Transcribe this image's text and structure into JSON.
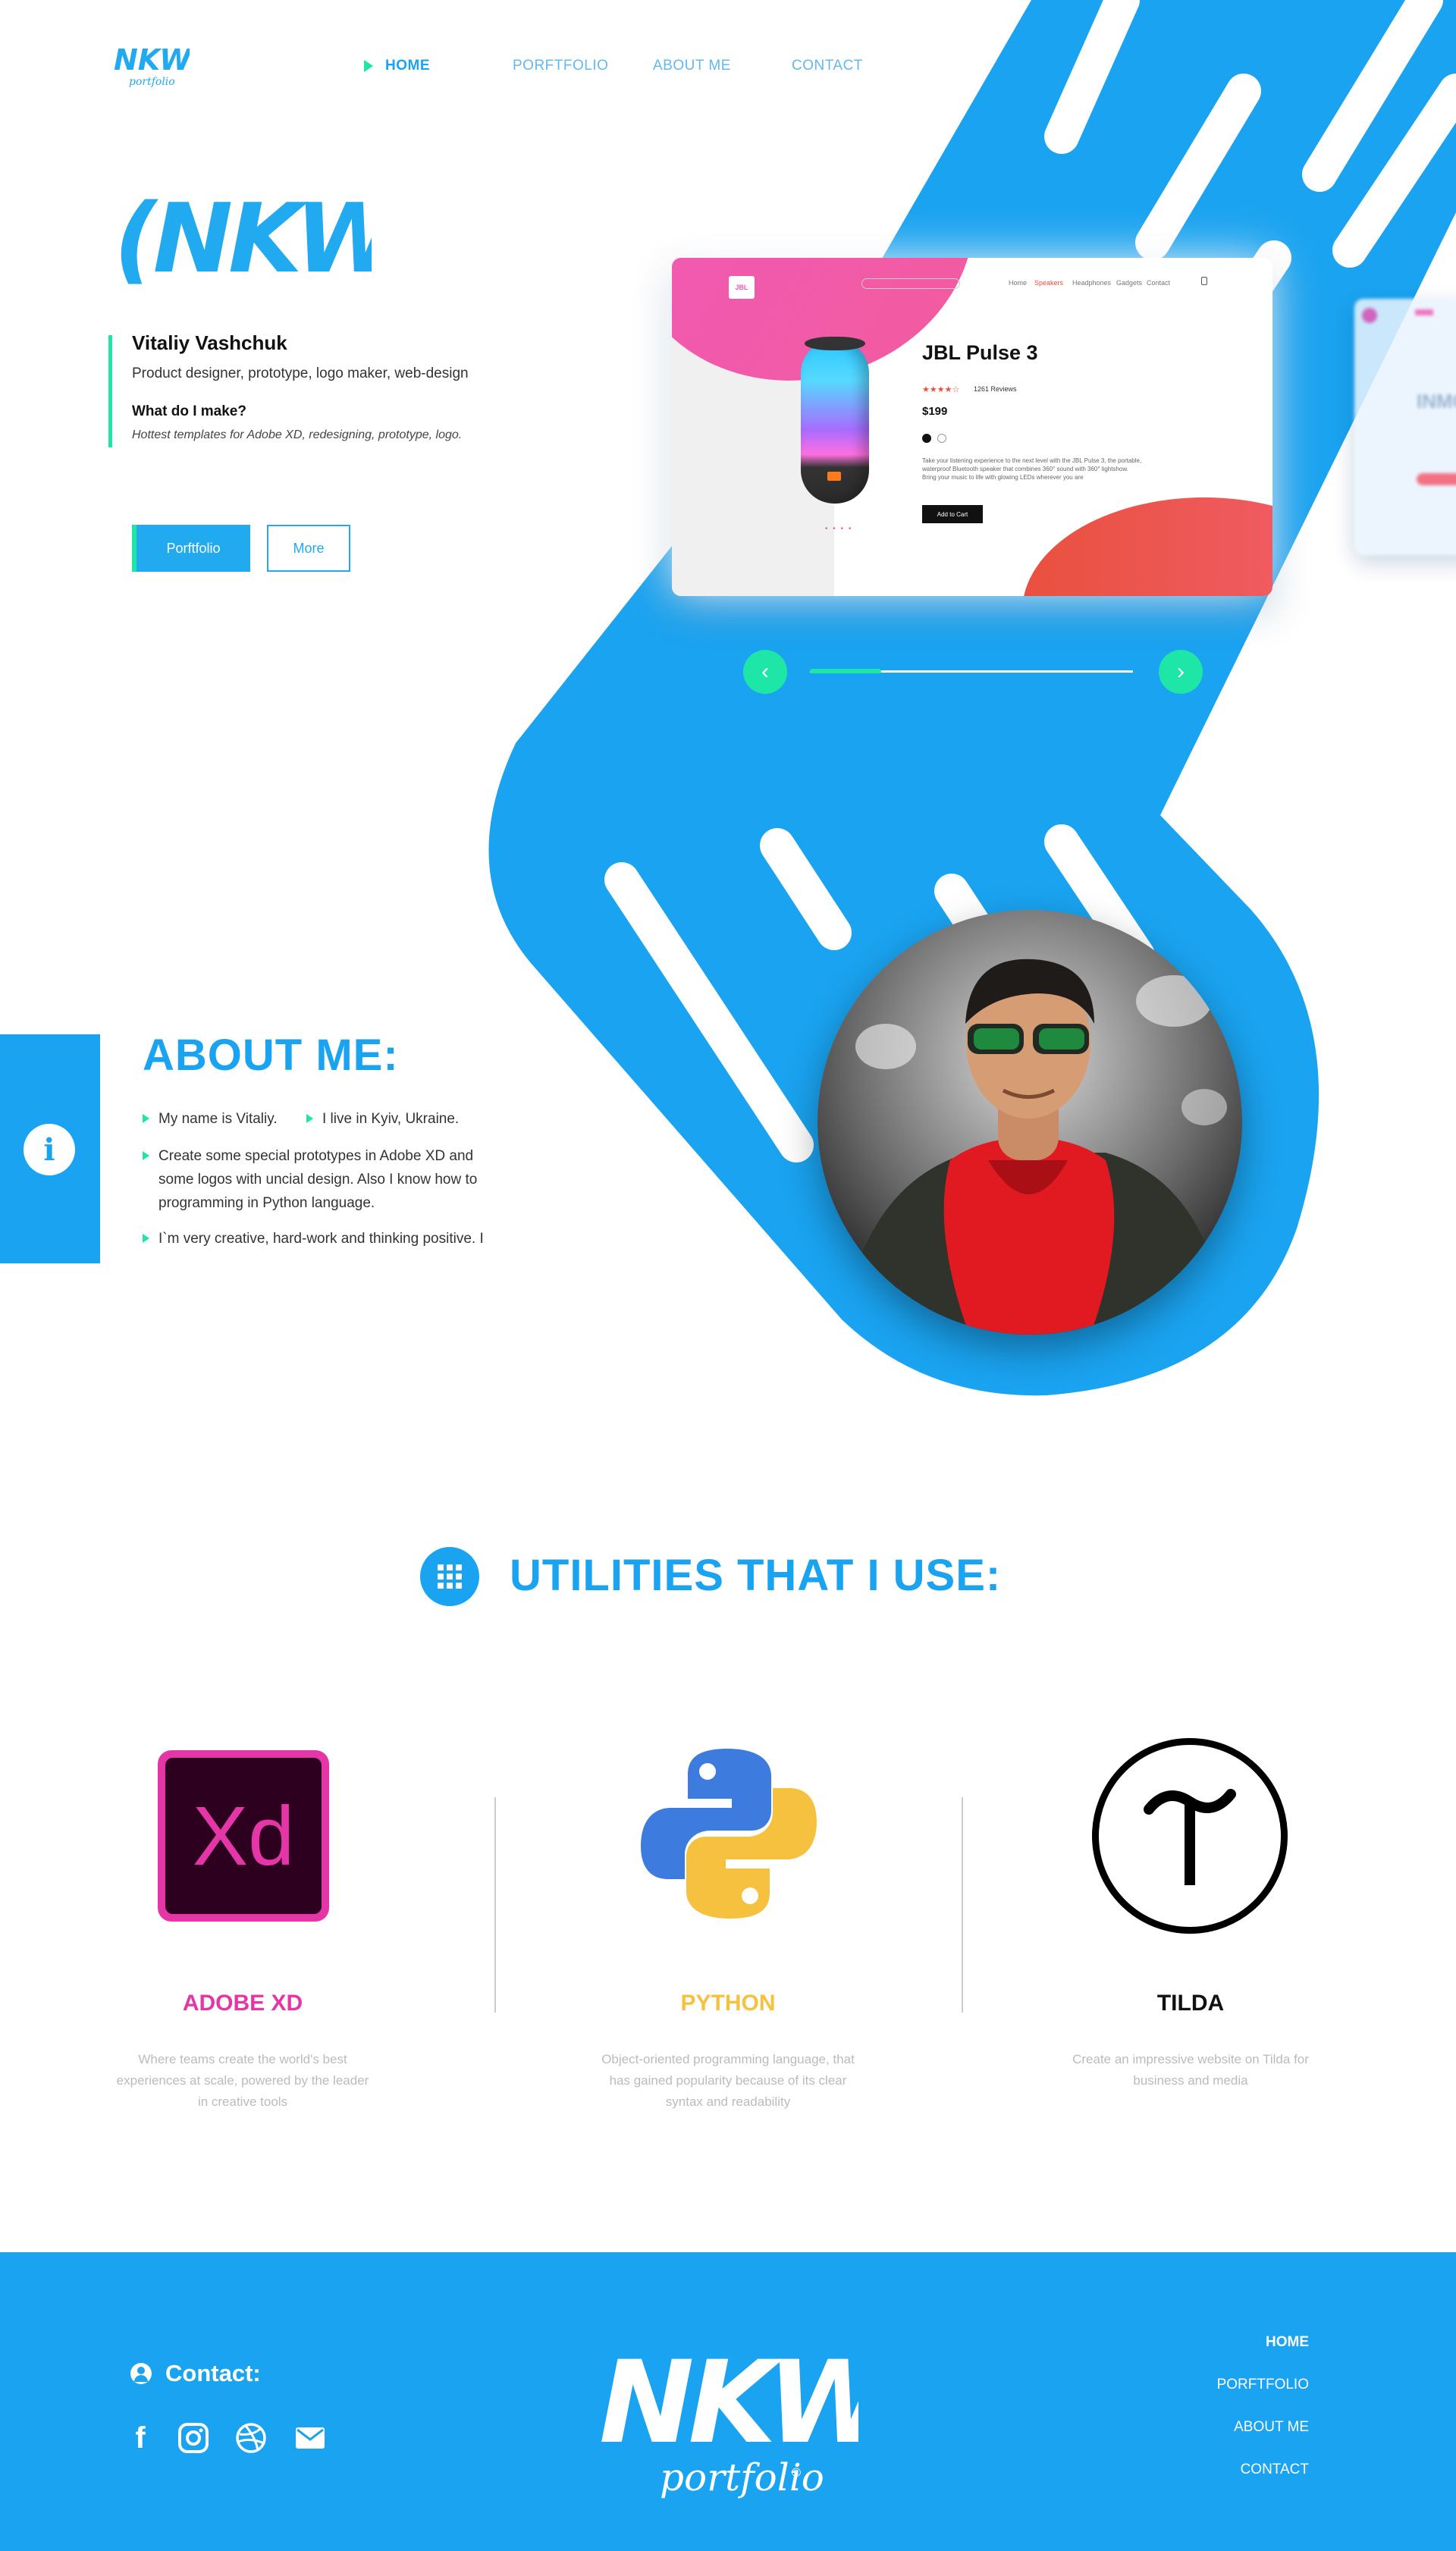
{
  "nav": {
    "logo_text": "NKW",
    "logo_sub": "portfolio",
    "items": [
      {
        "label": "HOME",
        "active": true
      },
      {
        "label": "PORFTFOLIO",
        "active": false
      },
      {
        "label": "ABOUT ME",
        "active": false
      },
      {
        "label": "CONTACT",
        "active": false
      }
    ]
  },
  "hero": {
    "logo_text": "(NKW)",
    "name": "Vitaliy Vashchuk",
    "role": "Product designer, prototype, logo maker, web-design",
    "question": "What do I make?",
    "answer": "Hottest templates for Adobe XD, redesigning, prototype, logo.",
    "btn_primary": "Porftfolio",
    "btn_secondary": "More"
  },
  "showcase": {
    "brand": "JBL",
    "nav": [
      "Home",
      "Speakers",
      "Headphones",
      "Gadgets",
      "Contact"
    ],
    "product_title": "JBL Pulse 3",
    "rating_stars": "★★★★☆",
    "reviews": "1261 Reviews",
    "price": "$199",
    "description": "Take your listening experience to the next level with the JBL Pulse 3, the portable, waterproof Bluetooth speaker that combines 360° sound with 360° lightshow. Bring your music to life with glowing LEDs wherever you are",
    "add_btn": "Add to Cart",
    "dots": "• • • •",
    "next_card_text": "INMO",
    "prev_arrow": "‹",
    "next_arrow": "›",
    "progress": 0.22
  },
  "about": {
    "info_glyph": "i",
    "title": "ABOUT ME:",
    "items": [
      "My name is Vitaliy.",
      "I live in Kyiv, Ukraine.",
      "Create some special prototypes in Adobe XD and",
      "some logos with uncial design. Also I know how to",
      "programming in Python language.",
      "I`m very creative, hard-work and thinking positive. I"
    ]
  },
  "utilities": {
    "title": "UTILITIES THAT I USE:",
    "items": [
      {
        "name": "ADOBE XD",
        "color": "#e536a8",
        "icon_text": "Xd",
        "desc": [
          "Where teams create the world's best",
          "experiences at scale, powered by the leader",
          "in creative tools"
        ]
      },
      {
        "name": "PYTHON",
        "color": "#f6c13e",
        "icon_text": "",
        "desc": [
          "Object-oriented programming language, that",
          "has gained popularity because of its clear",
          "syntax and readability"
        ]
      },
      {
        "name": "TILDA",
        "color": "#111111",
        "icon_text": "T",
        "desc": [
          "Create an impressive website on Tilda for",
          "business and media"
        ]
      }
    ]
  },
  "footer": {
    "contact_label": "Contact:",
    "logo_text": "NKW",
    "logo_sub": "portfolio",
    "logo_mark": "®",
    "social": [
      {
        "icon": "facebook-icon",
        "glyph": "f"
      },
      {
        "icon": "instagram-icon",
        "glyph": ""
      },
      {
        "icon": "dribbble-icon",
        "glyph": ""
      },
      {
        "icon": "mail-icon",
        "glyph": ""
      }
    ],
    "nav": [
      "HOME",
      "PORFTFOLIO",
      "ABOUT ME",
      "CONTACT"
    ]
  },
  "colors": {
    "brand_blue": "#1aa3f0",
    "accent_green": "#1ee6a6",
    "xd_pink": "#e536a8",
    "python_yellow": "#f6c13e"
  }
}
